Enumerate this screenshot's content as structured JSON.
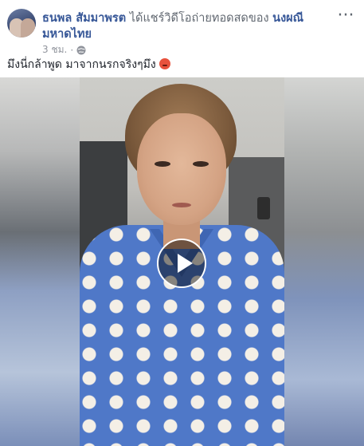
{
  "post": {
    "author": "ธนพล สัมมาพรต",
    "action": "ได้แชร์วิดีโอถ่ายทอดสดของ",
    "subject": "นงผณี มหาดไทย",
    "time": "3 ชม.",
    "privacy_icon": "globe-icon",
    "menu_icon": "more-options-icon",
    "text": "มึงนี่กล้าพูด มาจากนรกจริงๆมึง",
    "emoji": "angry-face-emoji"
  },
  "video": {
    "play_icon": "play-icon"
  },
  "colors": {
    "link": "#385898",
    "meta": "#90949c",
    "shirt": "#4f78c8"
  }
}
